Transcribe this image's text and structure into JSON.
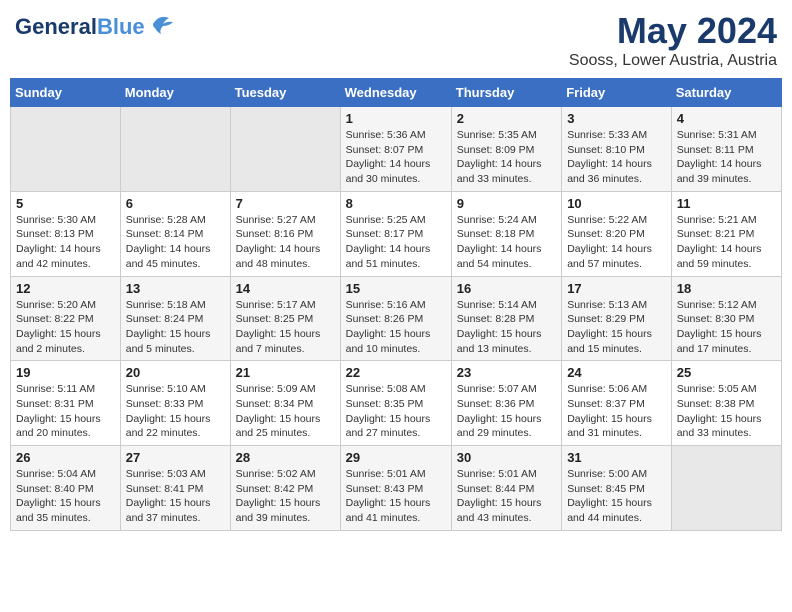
{
  "header": {
    "logo_general": "General",
    "logo_blue": "Blue",
    "month": "May 2024",
    "location": "Sooss, Lower Austria, Austria"
  },
  "weekdays": [
    "Sunday",
    "Monday",
    "Tuesday",
    "Wednesday",
    "Thursday",
    "Friday",
    "Saturday"
  ],
  "weeks": [
    [
      {
        "day": "",
        "empty": true
      },
      {
        "day": "",
        "empty": true
      },
      {
        "day": "",
        "empty": true
      },
      {
        "day": "1",
        "sunrise": "Sunrise: 5:36 AM",
        "sunset": "Sunset: 8:07 PM",
        "daylight": "Daylight: 14 hours and 30 minutes."
      },
      {
        "day": "2",
        "sunrise": "Sunrise: 5:35 AM",
        "sunset": "Sunset: 8:09 PM",
        "daylight": "Daylight: 14 hours and 33 minutes."
      },
      {
        "day": "3",
        "sunrise": "Sunrise: 5:33 AM",
        "sunset": "Sunset: 8:10 PM",
        "daylight": "Daylight: 14 hours and 36 minutes."
      },
      {
        "day": "4",
        "sunrise": "Sunrise: 5:31 AM",
        "sunset": "Sunset: 8:11 PM",
        "daylight": "Daylight: 14 hours and 39 minutes."
      }
    ],
    [
      {
        "day": "5",
        "sunrise": "Sunrise: 5:30 AM",
        "sunset": "Sunset: 8:13 PM",
        "daylight": "Daylight: 14 hours and 42 minutes."
      },
      {
        "day": "6",
        "sunrise": "Sunrise: 5:28 AM",
        "sunset": "Sunset: 8:14 PM",
        "daylight": "Daylight: 14 hours and 45 minutes."
      },
      {
        "day": "7",
        "sunrise": "Sunrise: 5:27 AM",
        "sunset": "Sunset: 8:16 PM",
        "daylight": "Daylight: 14 hours and 48 minutes."
      },
      {
        "day": "8",
        "sunrise": "Sunrise: 5:25 AM",
        "sunset": "Sunset: 8:17 PM",
        "daylight": "Daylight: 14 hours and 51 minutes."
      },
      {
        "day": "9",
        "sunrise": "Sunrise: 5:24 AM",
        "sunset": "Sunset: 8:18 PM",
        "daylight": "Daylight: 14 hours and 54 minutes."
      },
      {
        "day": "10",
        "sunrise": "Sunrise: 5:22 AM",
        "sunset": "Sunset: 8:20 PM",
        "daylight": "Daylight: 14 hours and 57 minutes."
      },
      {
        "day": "11",
        "sunrise": "Sunrise: 5:21 AM",
        "sunset": "Sunset: 8:21 PM",
        "daylight": "Daylight: 14 hours and 59 minutes."
      }
    ],
    [
      {
        "day": "12",
        "sunrise": "Sunrise: 5:20 AM",
        "sunset": "Sunset: 8:22 PM",
        "daylight": "Daylight: 15 hours and 2 minutes."
      },
      {
        "day": "13",
        "sunrise": "Sunrise: 5:18 AM",
        "sunset": "Sunset: 8:24 PM",
        "daylight": "Daylight: 15 hours and 5 minutes."
      },
      {
        "day": "14",
        "sunrise": "Sunrise: 5:17 AM",
        "sunset": "Sunset: 8:25 PM",
        "daylight": "Daylight: 15 hours and 7 minutes."
      },
      {
        "day": "15",
        "sunrise": "Sunrise: 5:16 AM",
        "sunset": "Sunset: 8:26 PM",
        "daylight": "Daylight: 15 hours and 10 minutes."
      },
      {
        "day": "16",
        "sunrise": "Sunrise: 5:14 AM",
        "sunset": "Sunset: 8:28 PM",
        "daylight": "Daylight: 15 hours and 13 minutes."
      },
      {
        "day": "17",
        "sunrise": "Sunrise: 5:13 AM",
        "sunset": "Sunset: 8:29 PM",
        "daylight": "Daylight: 15 hours and 15 minutes."
      },
      {
        "day": "18",
        "sunrise": "Sunrise: 5:12 AM",
        "sunset": "Sunset: 8:30 PM",
        "daylight": "Daylight: 15 hours and 17 minutes."
      }
    ],
    [
      {
        "day": "19",
        "sunrise": "Sunrise: 5:11 AM",
        "sunset": "Sunset: 8:31 PM",
        "daylight": "Daylight: 15 hours and 20 minutes."
      },
      {
        "day": "20",
        "sunrise": "Sunrise: 5:10 AM",
        "sunset": "Sunset: 8:33 PM",
        "daylight": "Daylight: 15 hours and 22 minutes."
      },
      {
        "day": "21",
        "sunrise": "Sunrise: 5:09 AM",
        "sunset": "Sunset: 8:34 PM",
        "daylight": "Daylight: 15 hours and 25 minutes."
      },
      {
        "day": "22",
        "sunrise": "Sunrise: 5:08 AM",
        "sunset": "Sunset: 8:35 PM",
        "daylight": "Daylight: 15 hours and 27 minutes."
      },
      {
        "day": "23",
        "sunrise": "Sunrise: 5:07 AM",
        "sunset": "Sunset: 8:36 PM",
        "daylight": "Daylight: 15 hours and 29 minutes."
      },
      {
        "day": "24",
        "sunrise": "Sunrise: 5:06 AM",
        "sunset": "Sunset: 8:37 PM",
        "daylight": "Daylight: 15 hours and 31 minutes."
      },
      {
        "day": "25",
        "sunrise": "Sunrise: 5:05 AM",
        "sunset": "Sunset: 8:38 PM",
        "daylight": "Daylight: 15 hours and 33 minutes."
      }
    ],
    [
      {
        "day": "26",
        "sunrise": "Sunrise: 5:04 AM",
        "sunset": "Sunset: 8:40 PM",
        "daylight": "Daylight: 15 hours and 35 minutes."
      },
      {
        "day": "27",
        "sunrise": "Sunrise: 5:03 AM",
        "sunset": "Sunset: 8:41 PM",
        "daylight": "Daylight: 15 hours and 37 minutes."
      },
      {
        "day": "28",
        "sunrise": "Sunrise: 5:02 AM",
        "sunset": "Sunset: 8:42 PM",
        "daylight": "Daylight: 15 hours and 39 minutes."
      },
      {
        "day": "29",
        "sunrise": "Sunrise: 5:01 AM",
        "sunset": "Sunset: 8:43 PM",
        "daylight": "Daylight: 15 hours and 41 minutes."
      },
      {
        "day": "30",
        "sunrise": "Sunrise: 5:01 AM",
        "sunset": "Sunset: 8:44 PM",
        "daylight": "Daylight: 15 hours and 43 minutes."
      },
      {
        "day": "31",
        "sunrise": "Sunrise: 5:00 AM",
        "sunset": "Sunset: 8:45 PM",
        "daylight": "Daylight: 15 hours and 44 minutes."
      },
      {
        "day": "",
        "empty": true
      }
    ]
  ]
}
